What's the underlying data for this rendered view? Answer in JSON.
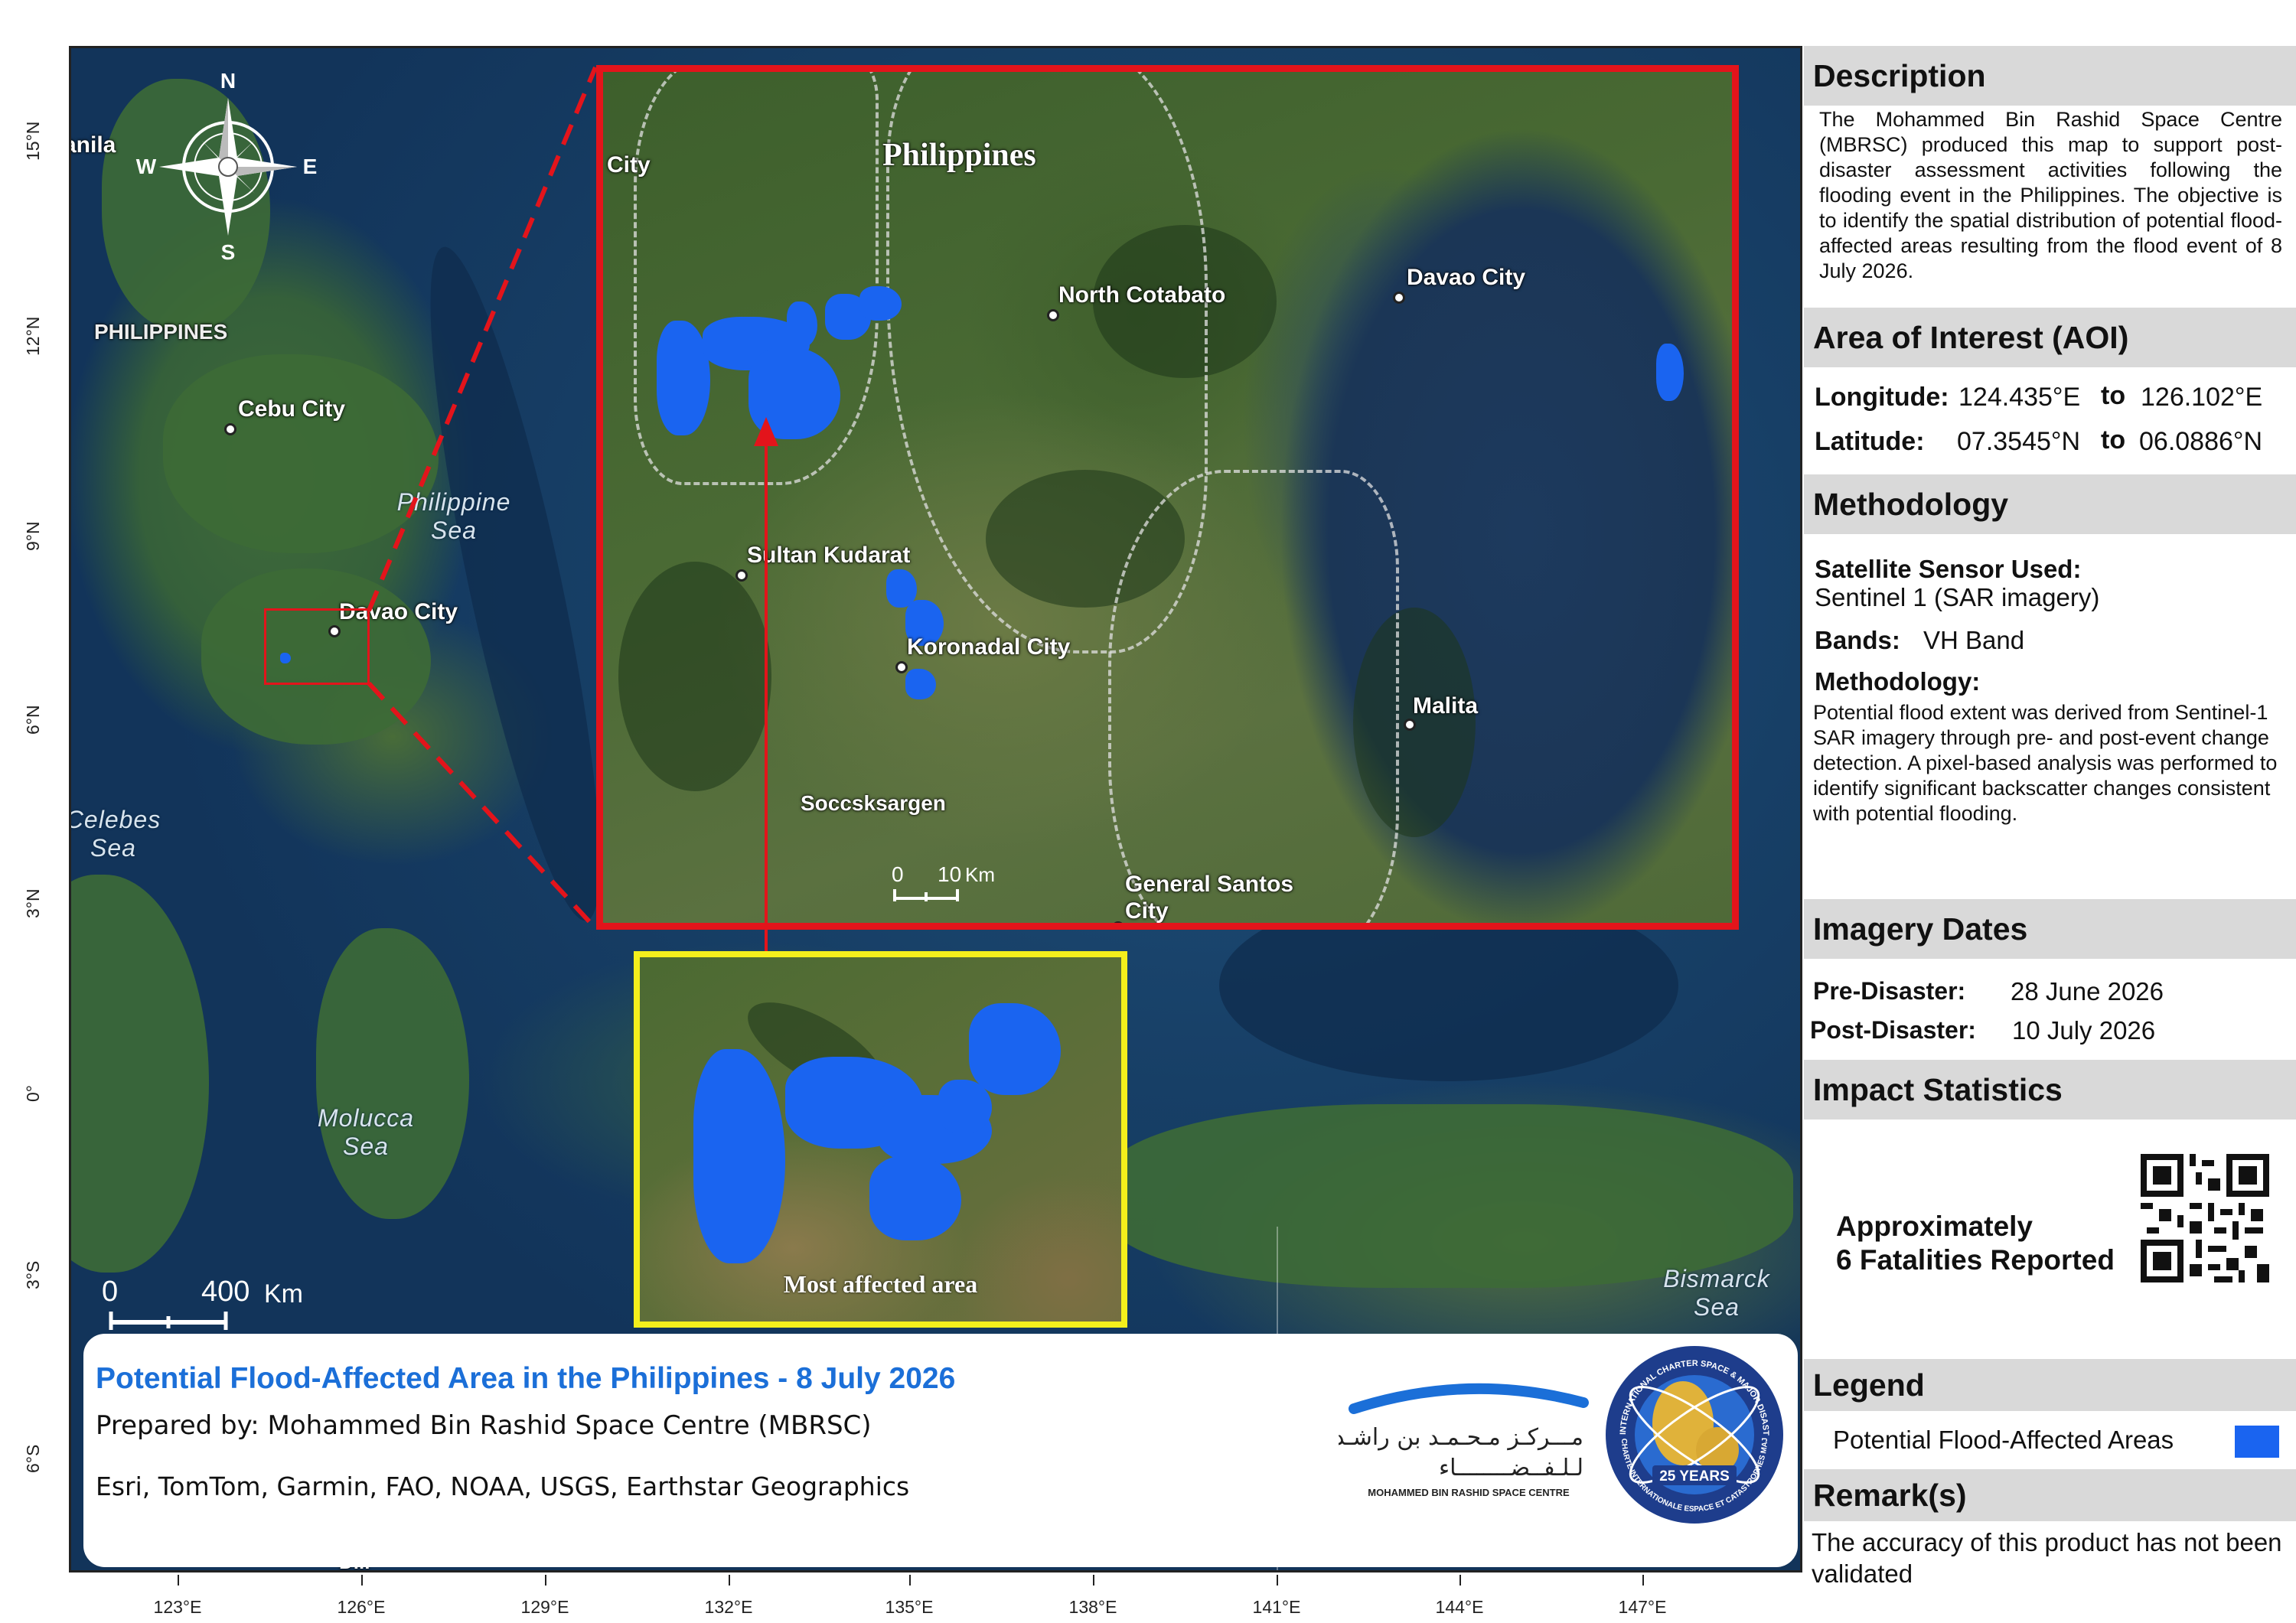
{
  "map": {
    "title": "Potential Flood-Affected Area in the Philippines - 8 July 2026",
    "prepared_by": "Prepared by: Mohammed Bin Rashid Space Centre (MBRSC)",
    "credits": "Esri, TomTom, Garmin, FAO, NOAA, USGS, Earthstar Geographics",
    "compass": {
      "n": "N",
      "s": "S",
      "e": "E",
      "w": "W"
    },
    "overview_labels": {
      "manila": "Manila",
      "philippines": "PHILIPPINES",
      "cebu": "Cebu City",
      "davao": "Davao City",
      "philippine_sea_1": "Philippine",
      "philippine_sea_2": "Sea",
      "celebes_1": "Celebes",
      "celebes_2": "Sea",
      "molucca_1": "Molucca",
      "molucca_2": "Sea",
      "bismarck_1": "Bismarck",
      "bismarck_2": "Sea",
      "dili": "Dili"
    },
    "overview_scale": {
      "start": "0",
      "end": "400",
      "unit": "Km"
    },
    "inset_labels": {
      "country": "Philippines",
      "city_edge": "City",
      "north_cotabato": "North Cotabato",
      "davao": "Davao City",
      "sultan_kudarat": "Sultan Kudarat",
      "koronadal": "Koronadal City",
      "malita": "Malita",
      "soccsksargen": "Soccsksargen",
      "general_santos_1": "General Santos",
      "general_santos_2": "City"
    },
    "inset_scale": {
      "start": "0",
      "end": "10",
      "unit": "Km"
    },
    "zoom_label": "Most affected area",
    "latitude_ticks": [
      "15°N",
      "12°N",
      "9°N",
      "6°N",
      "3°N",
      "0°",
      "3°S",
      "6°S"
    ],
    "longitude_ticks": [
      "123°E",
      "126°E",
      "129°E",
      "132°E",
      "135°E",
      "138°E",
      "141°E",
      "144°E",
      "147°E"
    ],
    "mbrsc_logo_arabic_1": "مـــركـز مـحـمـد بن راشـد",
    "mbrsc_logo_arabic_2": "لـلـفــضــــــــاء",
    "mbrsc_logo_english": "MOHAMMED BIN RASHID SPACE CENTRE",
    "charter_logo_top": "INTERNATIONAL CHARTER SPACE & MAJOR DISASTERS",
    "charter_logo_bottom": "CHARTE INTERNATIONALE ESPACE ET CATASTROPHES MAJEURES",
    "charter_logo_years": "25 YEARS",
    "colors": {
      "flood": "#1a64f0",
      "aoi_frame": "#e3141b",
      "zoom_frame": "#f4ef1c",
      "title": "#1b6fd8"
    }
  },
  "panel": {
    "description": {
      "header": "Description",
      "text": "The Mohammed Bin Rashid Space Centre (MBRSC) produced this map to support post-disaster assessment activities following the flooding event in the Philippines. The objective is to identify the spatial distribution of potential flood-affected areas resulting from the flood event of 8 July 2026."
    },
    "aoi": {
      "header": "Area of Interest (AOI)",
      "lon_key": "Longitude:",
      "lon_from": "124.435°E",
      "lon_to_word": "to",
      "lon_to": "126.102°E",
      "lat_key": "Latitude:",
      "lat_from": "07.3545°N",
      "lat_to_word": "to",
      "lat_to": "06.0886°N"
    },
    "methodology": {
      "header": "Methodology",
      "sensor_key": "Satellite Sensor Used:",
      "sensor_val": "Sentinel 1 (SAR imagery)",
      "bands_key": "Bands:",
      "bands_val": "VH Band",
      "method_key": "Methodology:",
      "method_text": "Potential flood extent was derived from Sentinel-1 SAR imagery through pre- and post-event change detection. A pixel-based analysis was performed to identify significant backscatter changes consistent with potential flooding."
    },
    "imagery": {
      "header": "Imagery Dates",
      "pre_key": "Pre-Disaster:",
      "pre_val": "28 June 2026",
      "post_key": "Post-Disaster:",
      "post_val": "10 July 2026"
    },
    "impact": {
      "header": "Impact Statistics",
      "line1": "Approximately",
      "line2": "6 Fatalities Reported"
    },
    "legend": {
      "header": "Legend",
      "item": "Potential Flood-Affected Areas"
    },
    "remarks": {
      "header": "Remark(s)",
      "text": "The accuracy of this product has not been validated"
    }
  }
}
